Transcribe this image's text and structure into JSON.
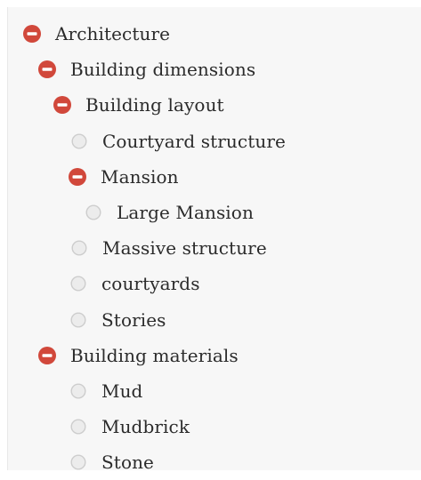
{
  "tree": [
    {
      "label": "Architecture",
      "level": 0,
      "state": "expanded"
    },
    {
      "label": "Building dimensions",
      "level": 1,
      "state": "expanded"
    },
    {
      "label": "Building layout",
      "level": 2,
      "state": "expanded"
    },
    {
      "label": "Courtyard structure",
      "level": 3,
      "state": "leaf"
    },
    {
      "label": "Mansion",
      "level": 3,
      "state": "expanded"
    },
    {
      "label": "Large Mansion",
      "level": 4,
      "state": "leaf"
    },
    {
      "label": "Massive structure",
      "level": 3,
      "state": "leaf"
    },
    {
      "label": "courtyards",
      "level": 2,
      "state": "leaf"
    },
    {
      "label": "Stories",
      "level": 2,
      "state": "leaf"
    },
    {
      "label": "Building materials",
      "level": 1,
      "state": "expanded"
    },
    {
      "label": "Mud",
      "level": 2,
      "state": "leaf"
    },
    {
      "label": "Mudbrick",
      "level": 2,
      "state": "leaf"
    },
    {
      "label": "Stone",
      "level": 2,
      "state": "leaf"
    }
  ],
  "colors": {
    "collapse_icon": "#d1483b",
    "leaf_icon_fill": "#ececec",
    "leaf_icon_border": "#cdcdcd",
    "text": "#2b2b2b",
    "panel_background": "#f7f7f7"
  }
}
